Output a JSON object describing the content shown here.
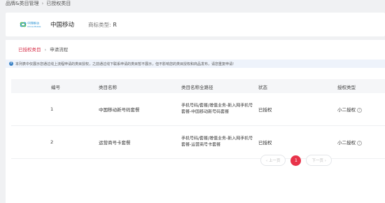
{
  "breadcrumb": {
    "root": "品牌&类目管理",
    "separator": "›",
    "current": "已授权类目"
  },
  "merchant": {
    "logo_text": "中国移动",
    "logo_subtext": "China Mobile",
    "name": "中国移动",
    "type_label": "商标类型:",
    "type_value": "R"
  },
  "sub_crumb": {
    "link": "已授权类目",
    "separator": "›",
    "current": "申请流程"
  },
  "notice": {
    "icon": "info-icon",
    "text": "本列表中仅展示您通过线上流程申请的类目授权，之前通过线下联系申请的类目暂不展示，但不影响您的类目授权和商品发布，请您重复申请!"
  },
  "table": {
    "headers": {
      "no": "编号",
      "name": "类目名称",
      "path": "类目名称全路径",
      "status": "状态",
      "type": "授权类型"
    },
    "rows": [
      {
        "no": "1",
        "name": "中国移动新号码套餐",
        "path": "手机号码/套餐/增值业务-新入网手机号套餐-中国移动新号码套餐",
        "status": "已授权",
        "type": "小二授权"
      },
      {
        "no": "2",
        "name": "运营商号卡套餐",
        "path": "手机号码/套餐/增值业务-新入网手机号套餐-运营商号卡套餐",
        "status": "已授权",
        "type": "小二授权"
      }
    ]
  },
  "pagination": {
    "prev": "‹ 上一页",
    "current": "1",
    "next": "下一页 ›"
  },
  "colors": {
    "accent": "#e8334a",
    "link": "#d6304a",
    "info": "#3b82c4"
  }
}
